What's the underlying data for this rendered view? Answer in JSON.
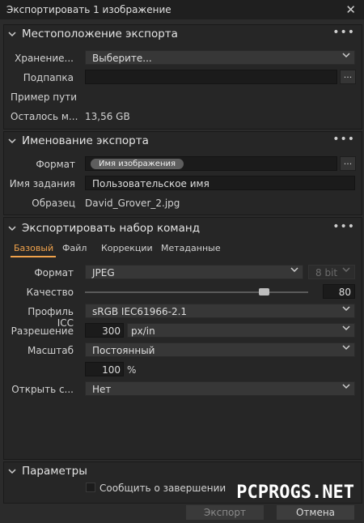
{
  "window": {
    "title": "Экспортировать 1 изображение",
    "close": "✕"
  },
  "export_location": {
    "title": "Местоположение экспорта",
    "storage_label": "Хранение...",
    "storage_value": "Выберите...",
    "subfolder_label": "Подпапка",
    "subfolder_value": "",
    "browse": "...",
    "path_example_label": "Пример пути",
    "remaining_label": "Осталось м...",
    "remaining_value": "13,56 GB"
  },
  "export_naming": {
    "title": "Именование экспорта",
    "format_label": "Формат",
    "format_token": "Имя изображения",
    "browse": "...",
    "job_name_label": "Имя задания",
    "job_name_value": "Пользовательское имя",
    "sample_label": "Образец",
    "sample_value": "David_Grover_2.jpg"
  },
  "recipe": {
    "title": "Экспортировать набор команд",
    "tabs": [
      "Базовый",
      "Файл",
      "Коррекции",
      "Метаданные"
    ],
    "active_tab": "Базовый",
    "format_label": "Формат",
    "format_value": "JPEG",
    "bit_value": "8 bit",
    "quality_label": "Качество",
    "quality_value": "80",
    "quality_fraction": 0.8,
    "icc_label": "Профиль ICC",
    "icc_value": "sRGB IEC61966-2.1",
    "resolution_label": "Разрешение",
    "resolution_value": "300",
    "resolution_unit": "px/in",
    "scale_label": "Масштаб",
    "scale_value": "Постоянный",
    "percent_value": "100",
    "percent_unit": "%",
    "open_with_label": "Открыть с...",
    "open_with_value": "Нет"
  },
  "parameters": {
    "title": "Параметры",
    "notify_label": "Сообщить о завершении",
    "notify_checked": false
  },
  "buttons": {
    "export": "Экспорт",
    "cancel": "Отмена"
  },
  "watermark": "PCPROGS.NET",
  "icons": {
    "chevron": "chevron-down-icon",
    "more": "more-dots-icon",
    "dropdown": "dropdown-arrow-icon"
  },
  "colors": {
    "accent": "#f0a24b",
    "background": "#2b2b2b",
    "panel": "#262626"
  }
}
